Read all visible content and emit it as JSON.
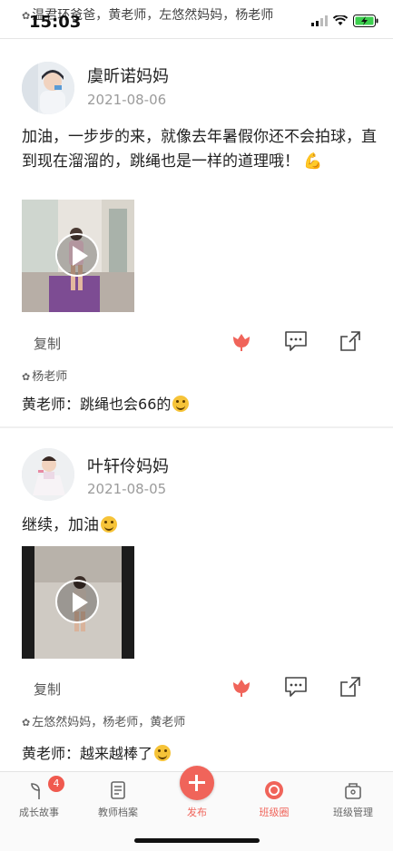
{
  "status_bar": {
    "time": "15:03"
  },
  "top_likes": "温君环爸爸，黄老师，左悠然妈妈，杨老师",
  "posts": [
    {
      "author": "虞昕诺妈妈",
      "date": "2021-08-06",
      "text": "加油，一步步的来，就像去年暑假你还不会拍球，直到现在溜溜的，跳绳也是一样的道理哦！",
      "copy_label": "复制",
      "likes": "杨老师",
      "comment_author": "黄老师：",
      "comment_text": "跳绳也会66的"
    },
    {
      "author": "叶轩伶妈妈",
      "date": "2021-08-05",
      "text": "继续，加油",
      "copy_label": "复制",
      "likes": "左悠然妈妈，杨老师，黄老师",
      "comment_author": "黄老师：",
      "comment_text": "越来越棒了"
    }
  ],
  "tabbar": {
    "tabs": [
      {
        "label": "成长故事",
        "badge": "4"
      },
      {
        "label": "教师档案"
      },
      {
        "label": "发布"
      },
      {
        "label": "班级圈"
      },
      {
        "label": "班级管理"
      }
    ]
  },
  "colors": {
    "accent": "#f0645a",
    "active_tab": "#f0645a",
    "separator": "#e6e6e6"
  }
}
